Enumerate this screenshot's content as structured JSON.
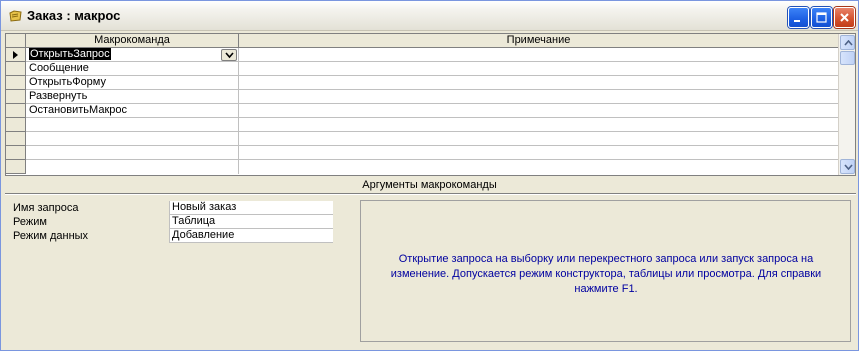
{
  "window": {
    "title": "Заказ : макрос",
    "icon": "macro-icon"
  },
  "grid": {
    "columns": [
      "Макрокоманда",
      "Примечание"
    ],
    "rows": [
      {
        "action": "ОткрытьЗапрос",
        "note": ""
      },
      {
        "action": "Сообщение",
        "note": ""
      },
      {
        "action": "ОткрытьФорму",
        "note": ""
      },
      {
        "action": "Развернуть",
        "note": ""
      },
      {
        "action": "ОстановитьМакрос",
        "note": ""
      },
      {
        "action": "",
        "note": ""
      },
      {
        "action": "",
        "note": ""
      },
      {
        "action": "",
        "note": ""
      }
    ]
  },
  "arguments": {
    "title": "Аргументы макрокоманды",
    "items": [
      {
        "label": "Имя запроса",
        "value": "Новый заказ"
      },
      {
        "label": "Режим",
        "value": "Таблица"
      },
      {
        "label": "Режим данных",
        "value": "Добавление"
      }
    ],
    "help": "Открытие запроса на выборку или перекрестного запроса или запуск запроса на изменение. Допускается режим конструктора, таблицы или просмотра. Для справки нажмите F1."
  },
  "colors": {
    "help_text": "#0000a0",
    "window_bg": "#ece9d8"
  }
}
